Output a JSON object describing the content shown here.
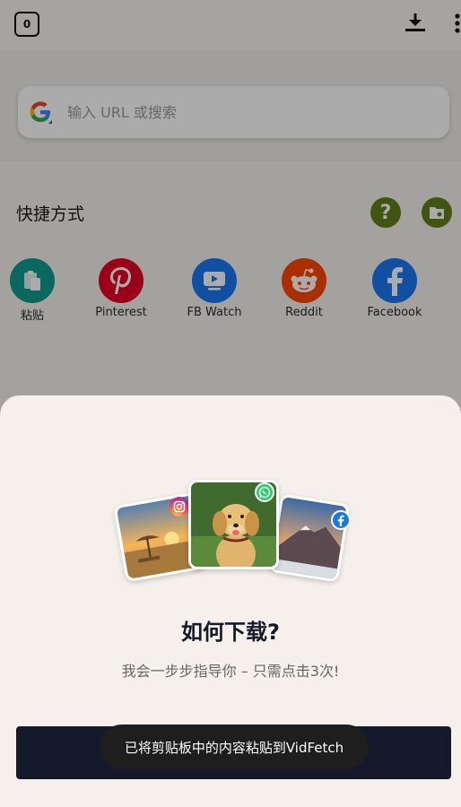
{
  "topbar": {
    "tab_count": "0",
    "download_icon": "download-icon",
    "more_icon": "more-vert-icon"
  },
  "search": {
    "placeholder": "输入 URL 或搜索",
    "engine_icon": "google-icon"
  },
  "shortcuts": {
    "title": "快捷方式",
    "help_icon": "help-icon",
    "folder_icon": "folder-settings-icon",
    "items": [
      {
        "label": "粘贴",
        "icon": "paste-icon",
        "color": "#0e9c8e"
      },
      {
        "label": "Pinterest",
        "icon": "pinterest-icon",
        "color": "#e60023"
      },
      {
        "label": "FB Watch",
        "icon": "fb-watch-icon",
        "color": "#1877f2"
      },
      {
        "label": "Reddit",
        "icon": "reddit-icon",
        "color": "#ff4500"
      },
      {
        "label": "Facebook",
        "icon": "facebook-icon",
        "color": "#1877f2"
      }
    ]
  },
  "sheet": {
    "title": "如何下载?",
    "subtitle": "我会一步步指导你 – 只需点击3次!",
    "button_label": ""
  },
  "toast": {
    "text": "已将剪贴板中的内容粘贴到VidFetch"
  },
  "colors": {
    "accent": "#5f7f18",
    "button_dark": "#141a2b",
    "sheet_bg": "#f5f0eb"
  }
}
